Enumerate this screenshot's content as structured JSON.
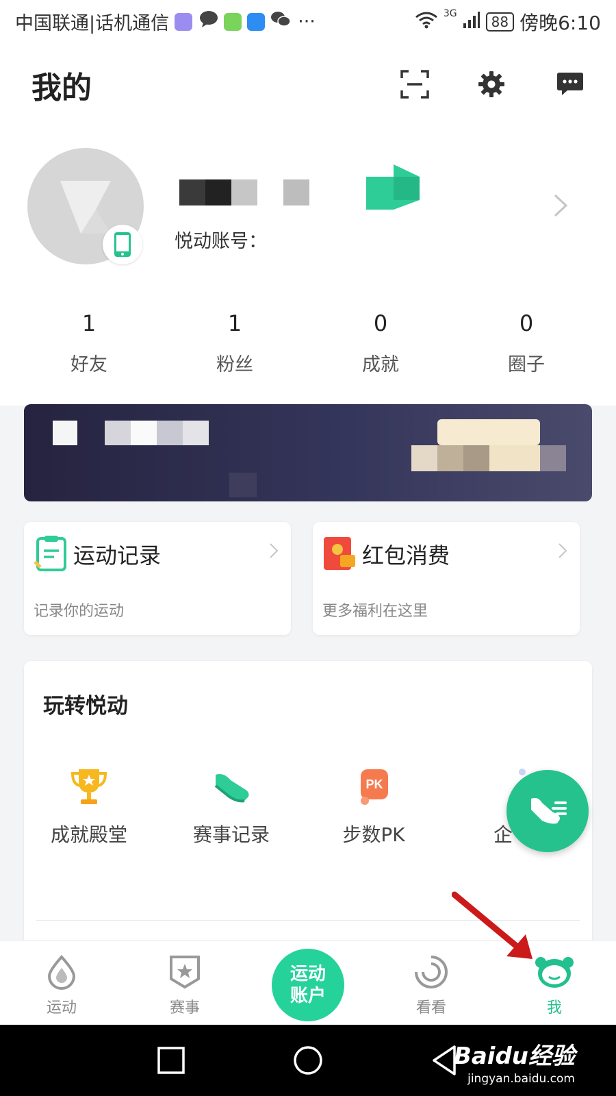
{
  "status_bar": {
    "carrier": "中国联通|话机通信",
    "more": "···",
    "network": "3G",
    "battery": "88",
    "time": "傍晚6:10"
  },
  "header": {
    "title": "我的",
    "icons": [
      "scan-icon",
      "gear-icon",
      "message-icon"
    ]
  },
  "profile": {
    "account_label": "悦动账号："
  },
  "stats": [
    {
      "value": "1",
      "label": "好友"
    },
    {
      "value": "1",
      "label": "粉丝"
    },
    {
      "value": "0",
      "label": "成就"
    },
    {
      "value": "0",
      "label": "圈子"
    }
  ],
  "cards": {
    "exercise": {
      "title": "运动记录",
      "subtitle": "记录你的运动"
    },
    "redpacket": {
      "title": "红包消费",
      "subtitle": "更多福利在这里"
    }
  },
  "play": {
    "title": "玩转悦动",
    "items": [
      {
        "label": "成就殿堂",
        "icon": "trophy-icon"
      },
      {
        "label": "赛事记录",
        "icon": "sneaker-icon"
      },
      {
        "label": "步数PK",
        "icon": "pk-icon"
      },
      {
        "label": "企",
        "icon": "enterprise-icon"
      }
    ]
  },
  "tabs": [
    {
      "label": "运动",
      "icon": "drop-icon"
    },
    {
      "label": "赛事",
      "icon": "badge-star-icon"
    },
    {
      "label": "运动\n账户",
      "icon": "center-button"
    },
    {
      "label": "看看",
      "icon": "swirl-icon"
    },
    {
      "label": "我",
      "icon": "bear-icon",
      "active": true
    }
  ],
  "watermark": {
    "brand": "Baidu经验",
    "url": "jingyan.baidu.com"
  },
  "colors": {
    "accent": "#25c28e",
    "banner": "#2e2d4d",
    "active_tab": "#22c08e"
  }
}
